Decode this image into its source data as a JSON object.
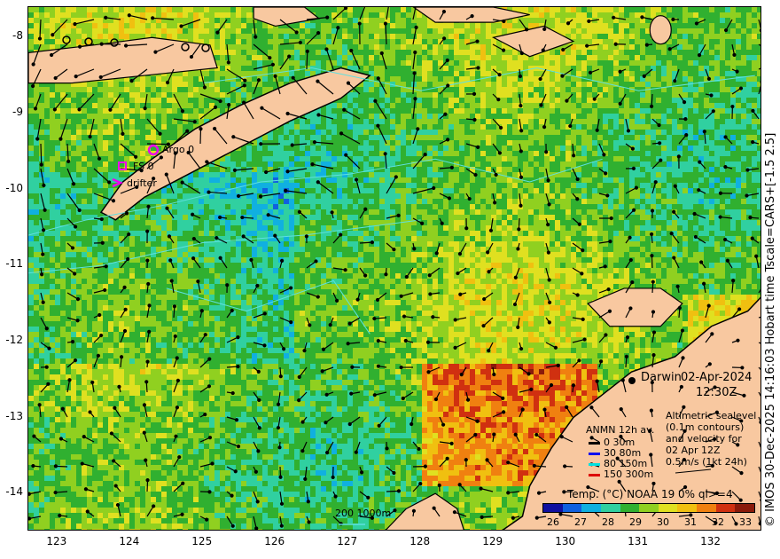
{
  "map": {
    "lon_range": [
      122.6,
      132.7
    ],
    "lat_range": [
      -14.5,
      -7.6
    ],
    "x_ticks": [
      "123",
      "124",
      "125",
      "126",
      "127",
      "128",
      "129",
      "130",
      "131",
      "132"
    ],
    "y_ticks": [
      "-8",
      "-9",
      "-10",
      "-11",
      "-12",
      "-13",
      "-14"
    ],
    "date": "02-Apr-2024",
    "time": "12:30Z",
    "side_label": "© IMOS 30-Dec-2025 14:16:03 Hobart time Tscale=CARS+[-1.5 2.5]",
    "place": "Darwin",
    "markers": {
      "argo": "Argo 0",
      "fs": "FS 0",
      "drifter": "drifter"
    },
    "marker_color": "#ee00ee",
    "land_color": "#f8c8a0",
    "anmn_title": "ANMN 12h av.",
    "anmn": [
      {
        "label": "0 30m",
        "color": "#000000"
      },
      {
        "label": "30 80m",
        "color": "#1010ee"
      },
      {
        "label": "80 150m",
        "color": "#00e0e0"
      },
      {
        "label": "150 300m",
        "color": "#dd0000"
      }
    ],
    "altimetry": [
      "Altimetric sealevel",
      "(0.1m contours)",
      "and velocity for",
      "02 Apr 12Z",
      "0.5m/s (1kt 24h)"
    ],
    "depth_label": "200  1000m",
    "colorbar_title": "Temp. (°C) NOAA 19 0% ql>=4",
    "colorbar_ticks": [
      "26",
      "27",
      "28",
      "29",
      "30",
      "31",
      "32",
      "33"
    ],
    "colorbar_colors": [
      "#1010a0",
      "#1060e0",
      "#10b0e0",
      "#30d0a0",
      "#30b030",
      "#90d020",
      "#e0e020",
      "#f0c010",
      "#f08010",
      "#d03010",
      "#8a1a0a"
    ]
  }
}
